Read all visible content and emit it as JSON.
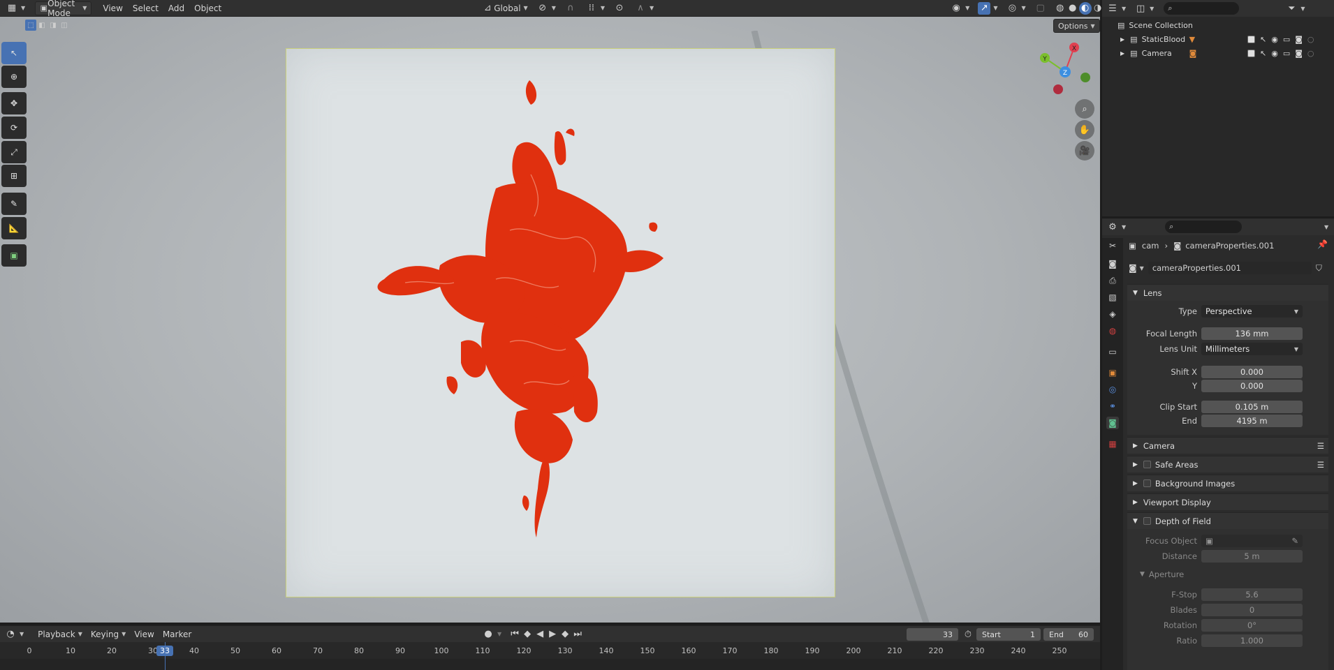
{
  "viewport_header": {
    "mode": "Object Mode",
    "menus": [
      "View",
      "Select",
      "Add",
      "Object"
    ],
    "orientation": "Global",
    "options_label": "Options"
  },
  "gizmo": {
    "x": "X",
    "y": "Y",
    "z": "Z"
  },
  "timeline": {
    "menus": [
      "Playback",
      "Keying",
      "View",
      "Marker"
    ],
    "current_frame": "33",
    "start_label": "Start",
    "start": "1",
    "end_label": "End",
    "end": "60",
    "ticks": [
      "0",
      "10",
      "20",
      "30",
      "40",
      "50",
      "60",
      "70",
      "80",
      "90",
      "100",
      "110",
      "120",
      "130",
      "140",
      "150",
      "160",
      "170",
      "180",
      "190",
      "200",
      "210",
      "220",
      "230",
      "240",
      "250"
    ]
  },
  "outliner": {
    "title": "Scene Collection",
    "items": [
      {
        "name": "StaticBlood"
      },
      {
        "name": "Camera"
      }
    ]
  },
  "properties": {
    "breadcrumb_object": "cam",
    "breadcrumb_data": "cameraProperties.001",
    "datablock": "cameraProperties.001",
    "lens": {
      "header": "Lens",
      "type_label": "Type",
      "type": "Perspective",
      "focal_label": "Focal Length",
      "focal": "136 mm",
      "unit_label": "Lens Unit",
      "unit": "Millimeters",
      "shiftx_label": "Shift X",
      "shiftx": "0.000",
      "shifty_label": "Y",
      "shifty": "0.000",
      "clipstart_label": "Clip Start",
      "clipstart": "0.105 m",
      "clipend_label": "End",
      "clipend": "4195 m"
    },
    "panels": {
      "camera": "Camera",
      "safe_areas": "Safe Areas",
      "background_images": "Background Images",
      "viewport_display": "Viewport Display",
      "dof": "Depth of Field"
    },
    "dof": {
      "focus_label": "Focus Object",
      "distance_label": "Distance",
      "distance": "5 m",
      "aperture": "Aperture",
      "fstop_label": "F-Stop",
      "fstop": "5.6",
      "blades_label": "Blades",
      "blades": "0",
      "rotation_label": "Rotation",
      "rotation": "0°",
      "ratio_label": "Ratio",
      "ratio": "1.000"
    }
  },
  "colors": {
    "accent": "#4772b3",
    "blood": "#e0300f",
    "frame_marker": "#4772b3"
  }
}
